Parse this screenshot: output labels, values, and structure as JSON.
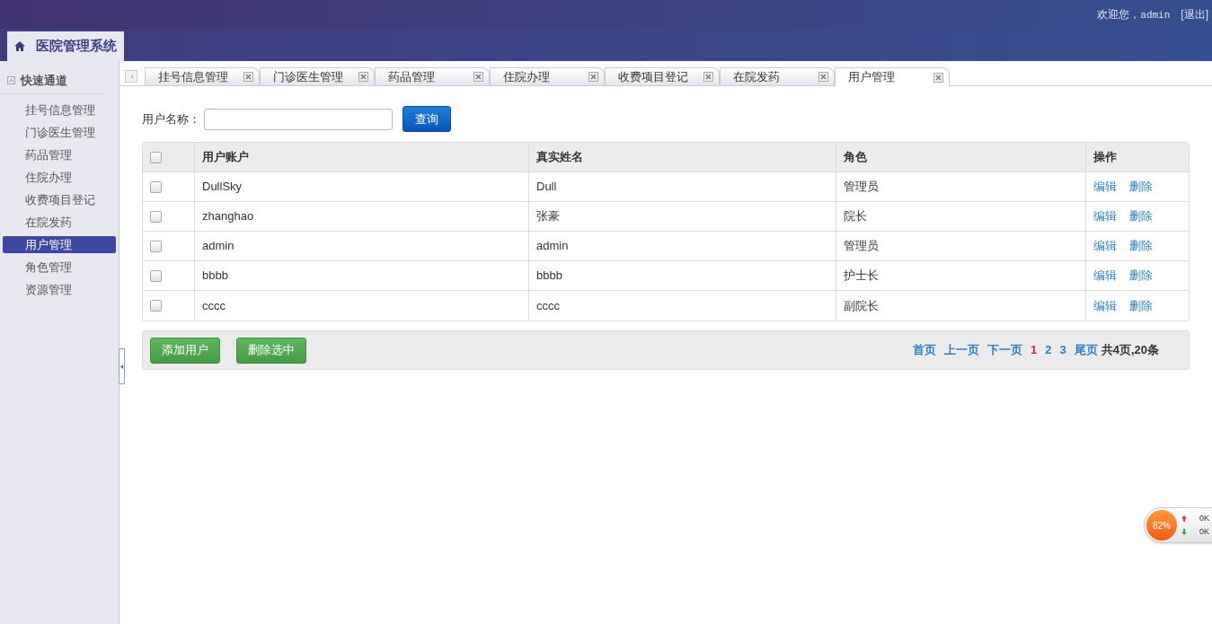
{
  "header": {
    "system_title": "医院管理系统",
    "welcome": "欢迎您，",
    "user": "admin",
    "logout": "[退出]"
  },
  "sidebar": {
    "title": "快速通道",
    "expanded": true,
    "items": [
      {
        "label": "挂号信息管理",
        "selected": false
      },
      {
        "label": "门诊医生管理",
        "selected": false
      },
      {
        "label": "药品管理",
        "selected": false
      },
      {
        "label": "住院办理",
        "selected": false
      },
      {
        "label": "收费项目登记",
        "selected": false
      },
      {
        "label": "在院发药",
        "selected": false
      },
      {
        "label": "用户管理",
        "selected": true
      },
      {
        "label": "角色管理",
        "selected": false
      },
      {
        "label": "资源管理",
        "selected": false
      }
    ]
  },
  "tabs": [
    {
      "label": "挂号信息管理",
      "selected": false
    },
    {
      "label": "门诊医生管理",
      "selected": false
    },
    {
      "label": "药品管理",
      "selected": false
    },
    {
      "label": "住院办理",
      "selected": false
    },
    {
      "label": "收费项目登记",
      "selected": false
    },
    {
      "label": "在院发药",
      "selected": false
    },
    {
      "label": "用户管理",
      "selected": true
    }
  ],
  "search": {
    "label": "用户名称：",
    "button": "查询"
  },
  "table": {
    "columns": [
      "用户账户",
      "真实姓名",
      "角色",
      "操作"
    ],
    "header_checked": false,
    "rows": [
      {
        "checked": false,
        "account": "DullSky",
        "name": "Dull",
        "role": "管理员",
        "actions": [
          "编辑",
          "删除"
        ]
      },
      {
        "checked": false,
        "account": "zhanghao",
        "name": "张豪",
        "role": "院长",
        "actions": [
          "编辑",
          "删除"
        ]
      },
      {
        "checked": false,
        "account": "admin",
        "name": "admin",
        "role": "管理员",
        "actions": [
          "编辑",
          "删除"
        ]
      },
      {
        "checked": false,
        "account": "bbbb",
        "name": "bbbb",
        "role": "护士长",
        "actions": [
          "编辑",
          "删除"
        ]
      },
      {
        "checked": false,
        "account": "cccc",
        "name": "cccc",
        "role": "副院长",
        "actions": [
          "编辑",
          "删除"
        ]
      }
    ]
  },
  "footer": {
    "buttons": [
      "添加用户",
      "删除选中"
    ],
    "pagination": {
      "links": [
        "首页",
        "上一页",
        "下一页"
      ],
      "pages": [
        {
          "label": "1",
          "selected": true
        },
        {
          "label": "2",
          "selected": false
        },
        {
          "label": "3",
          "selected": false
        }
      ],
      "last": "尾页",
      "summary": "共4页,20条"
    }
  },
  "speed_widget": {
    "percent": "82%",
    "up": "0K",
    "down": "0K"
  }
}
